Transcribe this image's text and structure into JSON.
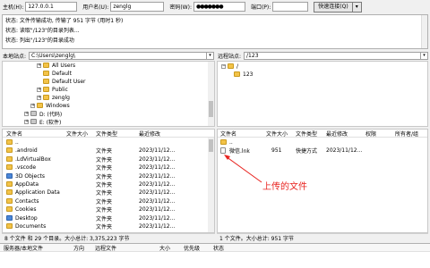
{
  "quickconnect": {
    "host_label": "主机(H):",
    "host_value": "127.0.0.1",
    "user_label": "用户名(U):",
    "user_value": "zenglg",
    "pass_label": "密码(W):",
    "pass_value": "●●●●●●●",
    "port_label": "端口(P):",
    "port_value": "",
    "connect_label": "快速连接(Q)",
    "dropdown_glyph": "▾"
  },
  "log": [
    "状态: 文件传输成功, 传输了 951 字节 (用时1 秒)",
    "状态: 读取\"/123\"的目录列表...",
    "状态: 列出\"/123\"的目录成功"
  ],
  "local": {
    "path_label": "本地站点:",
    "path_value": "C:\\Users\\zenglg\\",
    "tree": [
      {
        "label": "All Users",
        "expander": "+"
      },
      {
        "label": "Default",
        "expander": ""
      },
      {
        "label": "Default User",
        "expander": ""
      },
      {
        "label": "Public",
        "expander": "+"
      },
      {
        "label": "zenglg",
        "expander": "+"
      },
      {
        "label": "Windows",
        "expander": "+"
      },
      {
        "label": "D: (代码)",
        "expander": "+"
      },
      {
        "label": "E: (软件)",
        "expander": "+"
      }
    ],
    "columns": [
      "文件名",
      "文件大小",
      "文件类型",
      "最近修改"
    ],
    "files": [
      {
        "name": "..",
        "size": "",
        "type": "",
        "modified": ""
      },
      {
        "name": ".android",
        "size": "",
        "type": "文件夹",
        "modified": "2023/11/12..."
      },
      {
        "name": ".LdVirtualBox",
        "size": "",
        "type": "文件夹",
        "modified": "2023/11/12..."
      },
      {
        "name": ".vscode",
        "size": "",
        "type": "文件夹",
        "modified": "2023/11/12..."
      },
      {
        "name": "3D Objects",
        "size": "",
        "type": "文件夹",
        "modified": "2023/11/12..."
      },
      {
        "name": "AppData",
        "size": "",
        "type": "文件夹",
        "modified": "2023/11/12..."
      },
      {
        "name": "Application Data",
        "size": "",
        "type": "文件夹",
        "modified": "2023/11/12..."
      },
      {
        "name": "Contacts",
        "size": "",
        "type": "文件夹",
        "modified": "2023/11/12..."
      },
      {
        "name": "Cookies",
        "size": "",
        "type": "文件夹",
        "modified": "2023/11/12..."
      },
      {
        "name": "Desktop",
        "size": "",
        "type": "文件夹",
        "modified": "2023/11/12..."
      },
      {
        "name": "Documents",
        "size": "",
        "type": "文件夹",
        "modified": "2023/11/12..."
      }
    ],
    "status": "8 个文件 和 29 个目录。大小总计: 3,375,223 字节"
  },
  "remote": {
    "path_label": "远程站点:",
    "path_value": "/123",
    "tree": [
      {
        "label": "/",
        "expander": "−"
      },
      {
        "label": "123",
        "expander": ""
      }
    ],
    "columns": [
      "文件名",
      "文件大小",
      "文件类型",
      "最近修改",
      "权限",
      "所有者/组"
    ],
    "files": [
      {
        "name": "..",
        "size": "",
        "type": "",
        "modified": "",
        "perm": "",
        "owner": ""
      },
      {
        "name": "微信.lnk",
        "size": "951",
        "type": "快捷方式",
        "modified": "2023/11/12...",
        "perm": "",
        "owner": ""
      }
    ],
    "status": "1 个文件。大小总计: 951 字节"
  },
  "queue": {
    "columns": [
      "服务器/本地文件",
      "方向",
      "远程文件",
      "大小",
      "优先级",
      "状态"
    ]
  },
  "annotation": {
    "text": "上传的文件",
    "color": "#e8231f"
  }
}
